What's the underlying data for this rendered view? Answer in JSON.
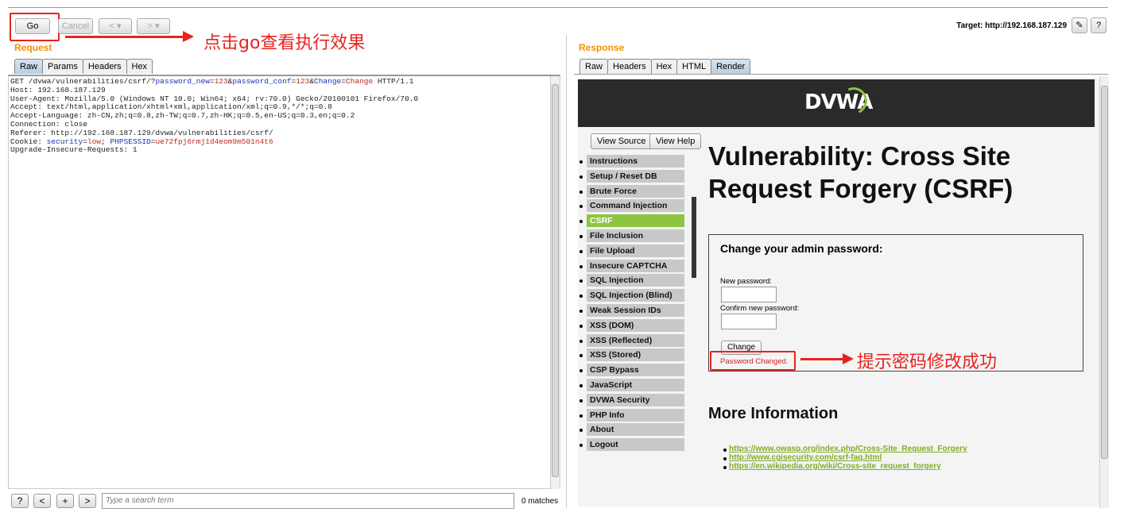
{
  "toolbar": {
    "go": "Go",
    "cancel": "Cancel",
    "back": "<",
    "forward": ">",
    "dropdown": "▾",
    "target": "Target: http://192.168.187.129",
    "edit_icon": "pencil-icon",
    "help": "?"
  },
  "annotations": {
    "go_note": "点击go查看执行效果",
    "result_note": "提示密码修改成功",
    "color": "#e8231e"
  },
  "request": {
    "title": "Request",
    "tabs": [
      "Raw",
      "Params",
      "Headers",
      "Hex"
    ],
    "line1": {
      "a": "GET /dvwa/vulnerabilities/csrf/?",
      "k1": "password_new",
      "e": "=",
      "v1": "123",
      "amp": "&",
      "k2": "password_conf",
      "v2": "123",
      "k3": "Change",
      "v3": "Change",
      "tail": " HTTP/1.1"
    },
    "lines": [
      "Host: 192.168.187.129",
      "User-Agent: Mozilla/5.0 (Windows NT 10.0; Win64; x64; rv:70.0) Gecko/20100101 Firefox/70.0",
      "Accept: text/html,application/xhtml+xml,application/xml;q=0.9,*/*;q=0.8",
      "Accept-Language: zh-CN,zh;q=0.8,zh-TW;q=0.7,zh-HK;q=0.5,en-US;q=0.3,en;q=0.2",
      "Connection: close",
      "Referer: http://192.168.187.129/dvwa/vulnerabilities/csrf/"
    ],
    "cookie": {
      "a": "Cookie: ",
      "k1": "security",
      "v1": "low",
      "sep": "; ",
      "k2": "PHPSESSID",
      "v2": "ue72fpj6rmj1d4eom9m501n4t6"
    },
    "last": "Upgrade-Insecure-Requests: 1",
    "search": {
      "help": "?",
      "prev": "<",
      "add": "+",
      "next": ">",
      "placeholder": "Type a search term",
      "matches": "0 matches"
    }
  },
  "response": {
    "title": "Response",
    "tabs": [
      "Raw",
      "Headers",
      "Hex",
      "HTML",
      "Render"
    ],
    "logo": "DVWA",
    "view_source": "View Source",
    "view_help": "View Help",
    "nav": [
      "Instructions",
      "Setup / Reset DB",
      "Brute Force",
      "Command Injection",
      "CSRF",
      "File Inclusion",
      "File Upload",
      "Insecure CAPTCHA",
      "SQL Injection",
      "SQL Injection (Blind)",
      "Weak Session IDs",
      "XSS (DOM)",
      "XSS (Reflected)",
      "XSS (Stored)",
      "CSP Bypass",
      "JavaScript",
      "DVWA Security",
      "PHP Info",
      "About",
      "Logout"
    ],
    "heading": "Vulnerability: Cross Site Request Forgery (CSRF)",
    "form": {
      "title": "Change your admin password:",
      "new_label": "New password:",
      "confirm_label": "Confirm new password:",
      "button": "Change",
      "status": "Password Changed."
    },
    "more": "More Information",
    "links": [
      "https://www.owasp.org/index.php/Cross-Site_Request_Forgery",
      "http://www.cgisecurity.com/csrf-faq.html",
      "https://en.wikipedia.org/wiki/Cross-site_request_forgery "
    ]
  }
}
